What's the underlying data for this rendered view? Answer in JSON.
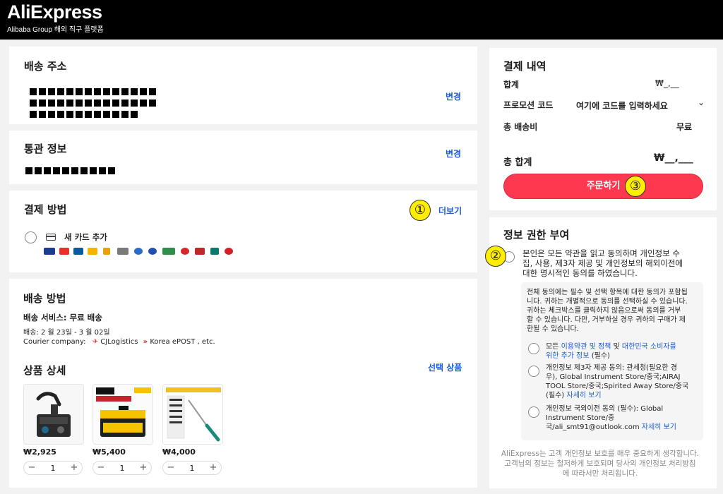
{
  "header": {
    "logo": "AliExpress",
    "logo_sub": "Alibaba Group 해외 직구 플랫폼"
  },
  "address": {
    "title": "배송 주소",
    "change_label": "변경"
  },
  "customs": {
    "title": "통관 정보",
    "change_label": "변경"
  },
  "payment": {
    "title": "결제 방법",
    "more_label": "더보기",
    "add_card_label": "새 카드 추가",
    "brand_colors": [
      "#1a3d8f",
      "#e8312a",
      "#0a5a9c",
      "#f5b400",
      "#e9a010",
      "#7a7a7a",
      "#2a6cc7",
      "#2050b0",
      "#2f8f4a",
      "#d9262c",
      "#c0272d",
      "#0b7a6a",
      "#d32027"
    ]
  },
  "annotations": {
    "one": "①",
    "two": "②",
    "three": "③"
  },
  "shipping": {
    "title": "배송 방법",
    "service_label": "배송 서비스: 무료 배송",
    "date_label": "배송: 2 월 23일 - 3 월 02일",
    "courier_prefix": "Courier company:",
    "courier_1": "CJLogistics",
    "courier_2": "Korea ePOST",
    "courier_suffix": ", etc."
  },
  "products": {
    "title": "상품 상세",
    "select_label": "선택 상품",
    "items": [
      {
        "price": "₩2,925",
        "qty": "1"
      },
      {
        "price": "₩5,400",
        "qty": "1"
      },
      {
        "price": "₩4,000",
        "qty": "1"
      }
    ],
    "minus": "−",
    "plus": "+"
  },
  "summary": {
    "title": "결제 내역",
    "subtotal_label": "합계",
    "subtotal_value": "₩_,__",
    "promo_label": "프로모션 코드",
    "promo_value": "여기에 코드를 입력하세요",
    "shipping_label": "총 배송비",
    "shipping_value": "무료",
    "total_label": "총 합계",
    "total_value": "₩__,___",
    "order_label": "주문하기"
  },
  "consent": {
    "title": "정보 권한 부여",
    "main_text_1": "본인은 모든 약관을 읽고 동의하며 개인정보 수",
    "main_text_2": "집, 사용, 제3자 제공 및 개인정보의 해외이전에",
    "main_text_3": "대한 명시적인 동의를 하였습니다.",
    "box_text_1": "전체 동의에는 필수 및 선택 항목에 대한 동의가 포함됩",
    "box_text_2": "니다. 귀하는 개별적으로 동의를 선택하실 수 있습니다.",
    "box_text_3": "귀하는 체크박스를 클릭하지 않음으로써 동의를 거부",
    "box_text_4": "할 수 있습니다. 다만, 거부하실 경우 귀하의 구매가 제",
    "box_text_5": "한될 수 있습니다.",
    "item1_a": "모든 ",
    "item1_b": "이용약관 및 정책",
    "item1_c": " 및 ",
    "item1_d": "대한민국 소비자를",
    "item1_e": "위한 추가 정보",
    "item1_f": " (필수)",
    "item2_1": "개인정보 제3자 제공 동의: 관세청(필요한 경",
    "item2_2": "우), Global Instrument Store/중국;AIRAJ",
    "item2_3": "TOOL Store/중국;Spirited Away Store/중국",
    "item2_4a": "(필수) ",
    "item2_4b": "자세히 보기",
    "item3_1": "개인정보 국외이전 동의 (필수): Global",
    "item3_2": "Instrument Store/중",
    "item3_3a": "국/ali_smt91@outlook.com ",
    "item3_3b": "자세히 보기",
    "footer_1": "AliExpress는 고객 개인정보 보호를 매우 중요하게 생각합니다.",
    "footer_2": "고객님의 정보는 철저하게 보호되며 당사의 개인정보 처리방침",
    "footer_3": "에 따라서만 처리됩니다."
  }
}
